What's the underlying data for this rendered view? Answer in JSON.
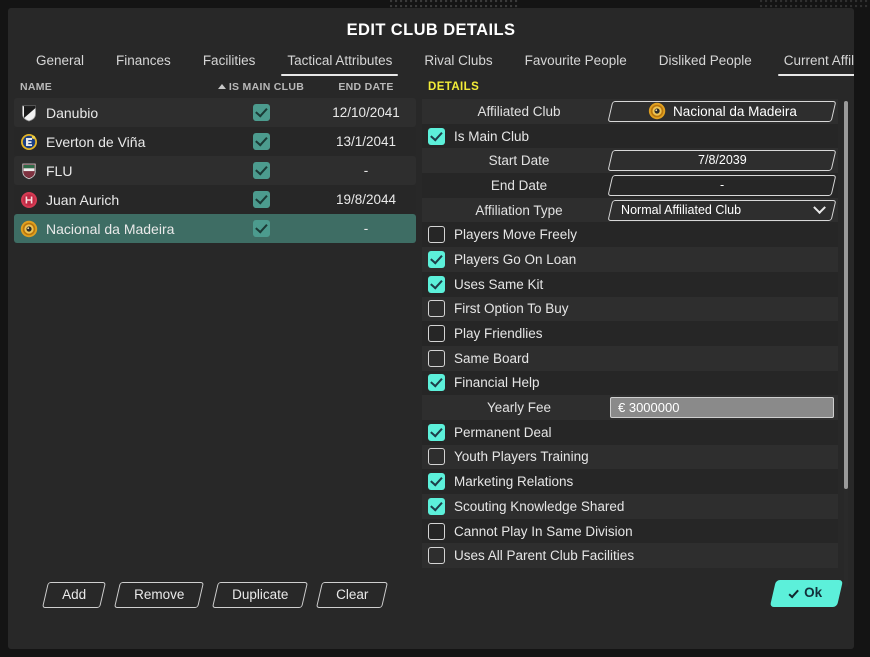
{
  "window": {
    "title": "EDIT CLUB DETAILS"
  },
  "tabs": [
    {
      "label": "General",
      "active": false
    },
    {
      "label": "Finances",
      "active": false
    },
    {
      "label": "Facilities",
      "active": false
    },
    {
      "label": "Tactical Attributes",
      "active": true
    },
    {
      "label": "Rival Clubs",
      "active": false
    },
    {
      "label": "Favourite People",
      "active": false
    },
    {
      "label": "Disliked People",
      "active": false
    },
    {
      "label": "Current Affiliations",
      "active": true
    }
  ],
  "list": {
    "headers": {
      "name": "NAME",
      "is_main_club": "IS MAIN CLUB",
      "end_date": "END DATE"
    },
    "sort_indicator": "ascending-sort-arrow",
    "rows": [
      {
        "name": "Danubio",
        "badge": "danubio-club-badge",
        "is_main_club": true,
        "end_date": "12/10/2041",
        "selected": false
      },
      {
        "name": "Everton de Viña",
        "badge": "everton-de-vina-club-badge",
        "is_main_club": true,
        "end_date": "13/1/2041",
        "selected": false
      },
      {
        "name": "FLU",
        "badge": "flu-club-badge",
        "is_main_club": true,
        "end_date": "-",
        "selected": false
      },
      {
        "name": "Juan Aurich",
        "badge": "juan-aurich-club-badge",
        "is_main_club": true,
        "end_date": "19/8/2044",
        "selected": false
      },
      {
        "name": "Nacional da Madeira",
        "badge": "nacional-da-madeira-club-badge",
        "is_main_club": true,
        "end_date": "-",
        "selected": true
      }
    ]
  },
  "list_buttons": [
    {
      "label": "Add"
    },
    {
      "label": "Remove"
    },
    {
      "label": "Duplicate"
    },
    {
      "label": "Clear"
    }
  ],
  "details": {
    "header": "DETAILS",
    "fields": [
      {
        "kind": "value",
        "label": "Affiliated Club",
        "value": "Nacional da Madeira",
        "badge": "nacional-da-madeira-club-badge"
      },
      {
        "kind": "check",
        "label": "Is Main Club",
        "checked": true
      },
      {
        "kind": "value",
        "label": "Start Date",
        "value": "7/8/2039"
      },
      {
        "kind": "value",
        "label": "End Date",
        "value": "-"
      },
      {
        "kind": "select",
        "label": "Affiliation Type",
        "value": "Normal Affiliated Club"
      },
      {
        "kind": "check",
        "label": "Players Move Freely",
        "checked": false
      },
      {
        "kind": "check",
        "label": "Players Go On Loan",
        "checked": true
      },
      {
        "kind": "check",
        "label": "Uses Same Kit",
        "checked": true
      },
      {
        "kind": "check",
        "label": "First Option To Buy",
        "checked": false
      },
      {
        "kind": "check",
        "label": "Play Friendlies",
        "checked": false
      },
      {
        "kind": "check",
        "label": "Same Board",
        "checked": false
      },
      {
        "kind": "check",
        "label": "Financial Help",
        "checked": true
      },
      {
        "kind": "input",
        "label": "Yearly Fee",
        "value": "€ 3000000"
      },
      {
        "kind": "check",
        "label": "Permanent Deal",
        "checked": true
      },
      {
        "kind": "check",
        "label": "Youth Players Training",
        "checked": false
      },
      {
        "kind": "check",
        "label": "Marketing Relations",
        "checked": true
      },
      {
        "kind": "check",
        "label": "Scouting Knowledge Shared",
        "checked": true
      },
      {
        "kind": "check",
        "label": "Cannot Play In Same Division",
        "checked": false
      },
      {
        "kind": "check",
        "label": "Uses All Parent Club Facilities",
        "checked": false
      }
    ]
  },
  "footer": {
    "ok_label": "Ok"
  },
  "colors": {
    "window_bg": "#282828",
    "row_odd": "#2e2e2e",
    "row_even": "#262626",
    "selected_row": "#3e6d64",
    "accent_cyan": "#5cf0da",
    "list_check_teal": "#4c9b8e",
    "details_header_yellow": "#f2ec38",
    "text_primary": "#e6e6e6"
  }
}
